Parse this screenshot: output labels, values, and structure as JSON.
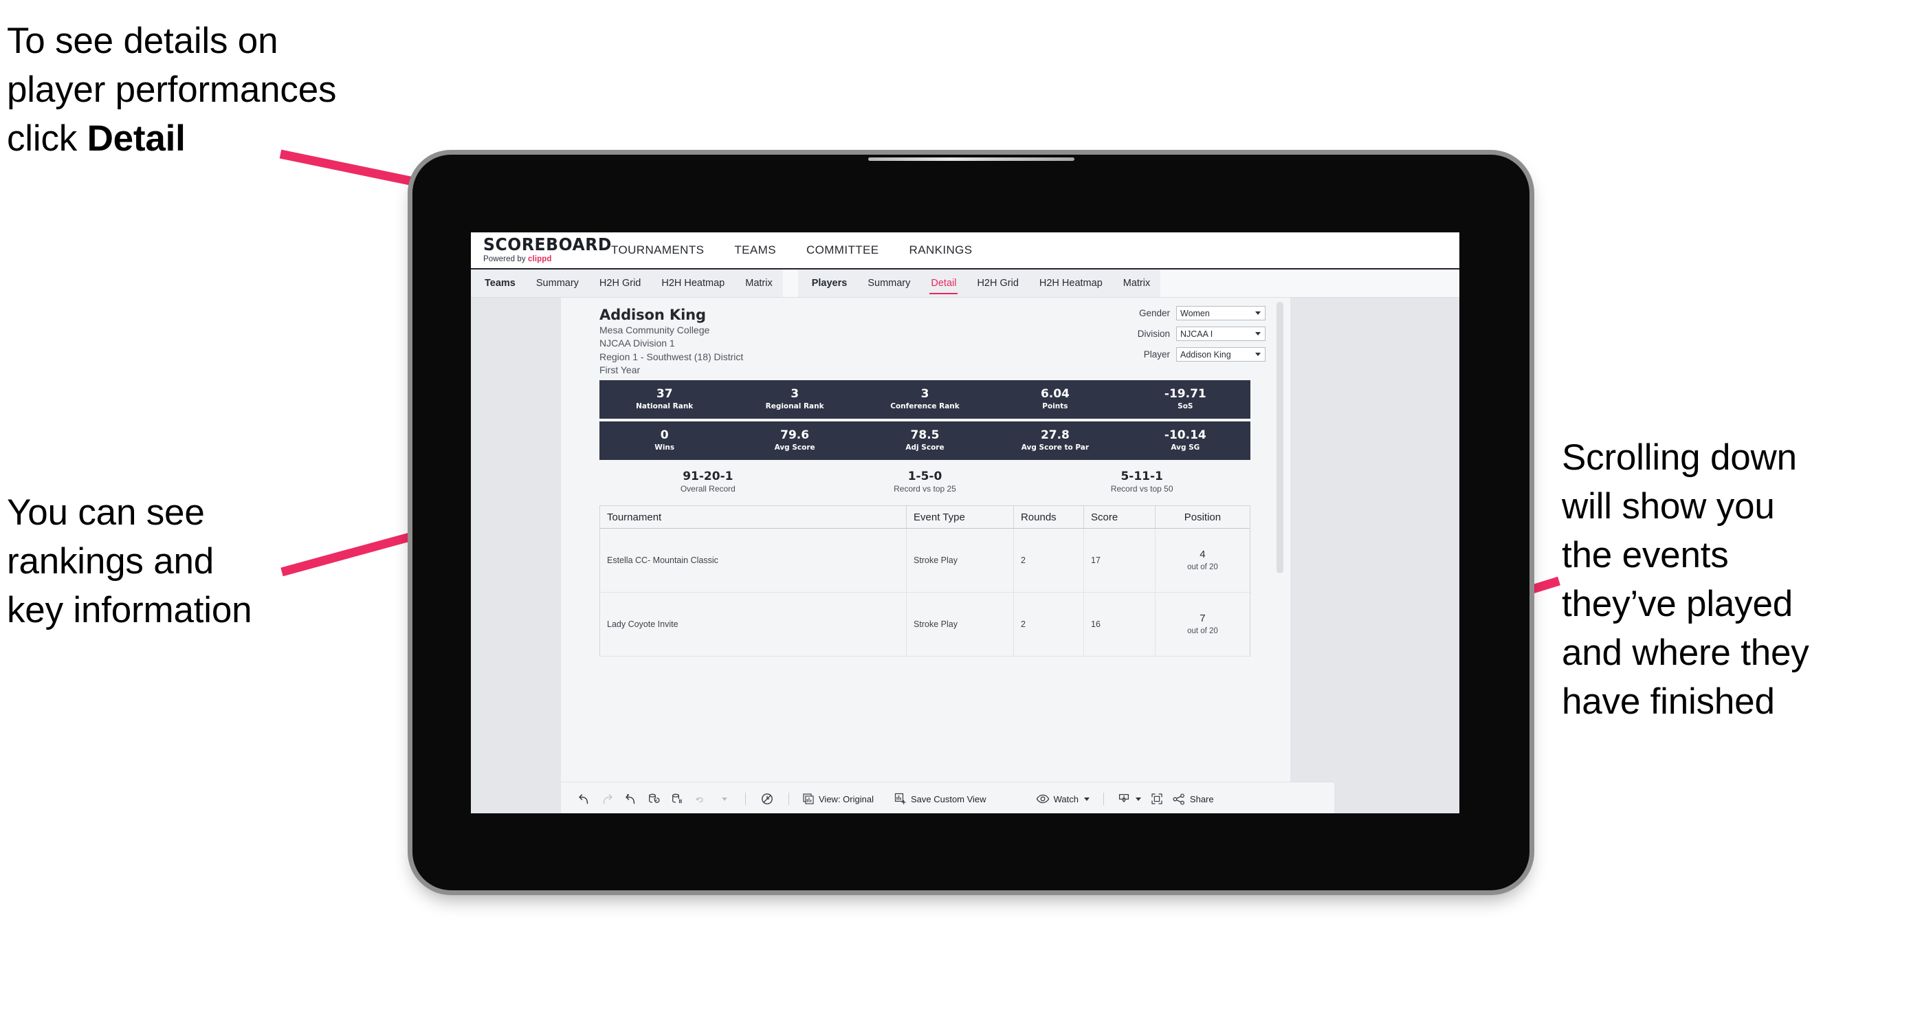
{
  "annotations": {
    "detail_note_pre": "To see details on\nplayer performances\nclick ",
    "detail_note_bold": "Detail",
    "rankings_note": "You can see\nrankings and\nkey information",
    "scrolling_note": "Scrolling down\nwill show you\nthe events\nthey’ve played\nand where they\nhave finished",
    "arrow_color": "#ED2B63"
  },
  "app": {
    "brand": {
      "title": "SCOREBOARD",
      "powered_prefix": "Powered by ",
      "powered_brand": "clippd"
    },
    "top_nav": [
      {
        "label": "TOURNAMENTS"
      },
      {
        "label": "TEAMS"
      },
      {
        "label": "COMMITTEE"
      },
      {
        "label": "RANKINGS"
      }
    ],
    "subtabs_teams": [
      {
        "label": "Teams",
        "lead": true
      },
      {
        "label": "Summary"
      },
      {
        "label": "H2H Grid"
      },
      {
        "label": "H2H Heatmap"
      },
      {
        "label": "Matrix"
      }
    ],
    "subtabs_players": [
      {
        "label": "Players",
        "lead": true
      },
      {
        "label": "Summary"
      },
      {
        "label": "Detail",
        "active": true
      },
      {
        "label": "H2H Grid"
      },
      {
        "label": "H2H Heatmap"
      },
      {
        "label": "Matrix"
      }
    ],
    "accent_color": "#E8295B",
    "stat_bar_color": "#2F3446"
  },
  "player": {
    "name": "Addison King",
    "school": "Mesa Community College",
    "division": "NJCAA Division 1",
    "region": "Region 1 - Southwest (18) District",
    "year": "First Year"
  },
  "filters": [
    {
      "label": "Gender",
      "value": "Women"
    },
    {
      "label": "Division",
      "value": "NJCAA I"
    },
    {
      "label": "Player",
      "value": "Addison King"
    }
  ],
  "stats_row_1": [
    {
      "value": "37",
      "label": "National Rank"
    },
    {
      "value": "3",
      "label": "Regional Rank"
    },
    {
      "value": "3",
      "label": "Conference Rank"
    },
    {
      "value": "6.04",
      "label": "Points"
    },
    {
      "value": "-19.71",
      "label": "SoS"
    }
  ],
  "stats_row_2": [
    {
      "value": "0",
      "label": "Wins"
    },
    {
      "value": "79.6",
      "label": "Avg Score"
    },
    {
      "value": "78.5",
      "label": "Adj Score"
    },
    {
      "value": "27.8",
      "label": "Avg Score to Par"
    },
    {
      "value": "-10.14",
      "label": "Avg SG"
    }
  ],
  "records": [
    {
      "value": "91-20-1",
      "label": "Overall Record"
    },
    {
      "value": "1-5-0",
      "label": "Record vs top 25"
    },
    {
      "value": "5-11-1",
      "label": "Record vs top 50"
    }
  ],
  "events_table": {
    "columns": [
      "Tournament",
      "Event Type",
      "Rounds",
      "Score",
      "Position"
    ],
    "rows": [
      {
        "tournament": "Estella CC- Mountain Classic",
        "event_type": "Stroke Play",
        "rounds": "2",
        "score": "17",
        "position_num": "4",
        "position_of": "out of 20"
      },
      {
        "tournament": "Lady Coyote Invite",
        "event_type": "Stroke Play",
        "rounds": "2",
        "score": "16",
        "position_num": "7",
        "position_of": "out of 20"
      }
    ]
  },
  "toolbar": {
    "view_label": "View: Original",
    "save_label": "Save Custom View",
    "watch_label": "Watch",
    "share_label": "Share"
  }
}
